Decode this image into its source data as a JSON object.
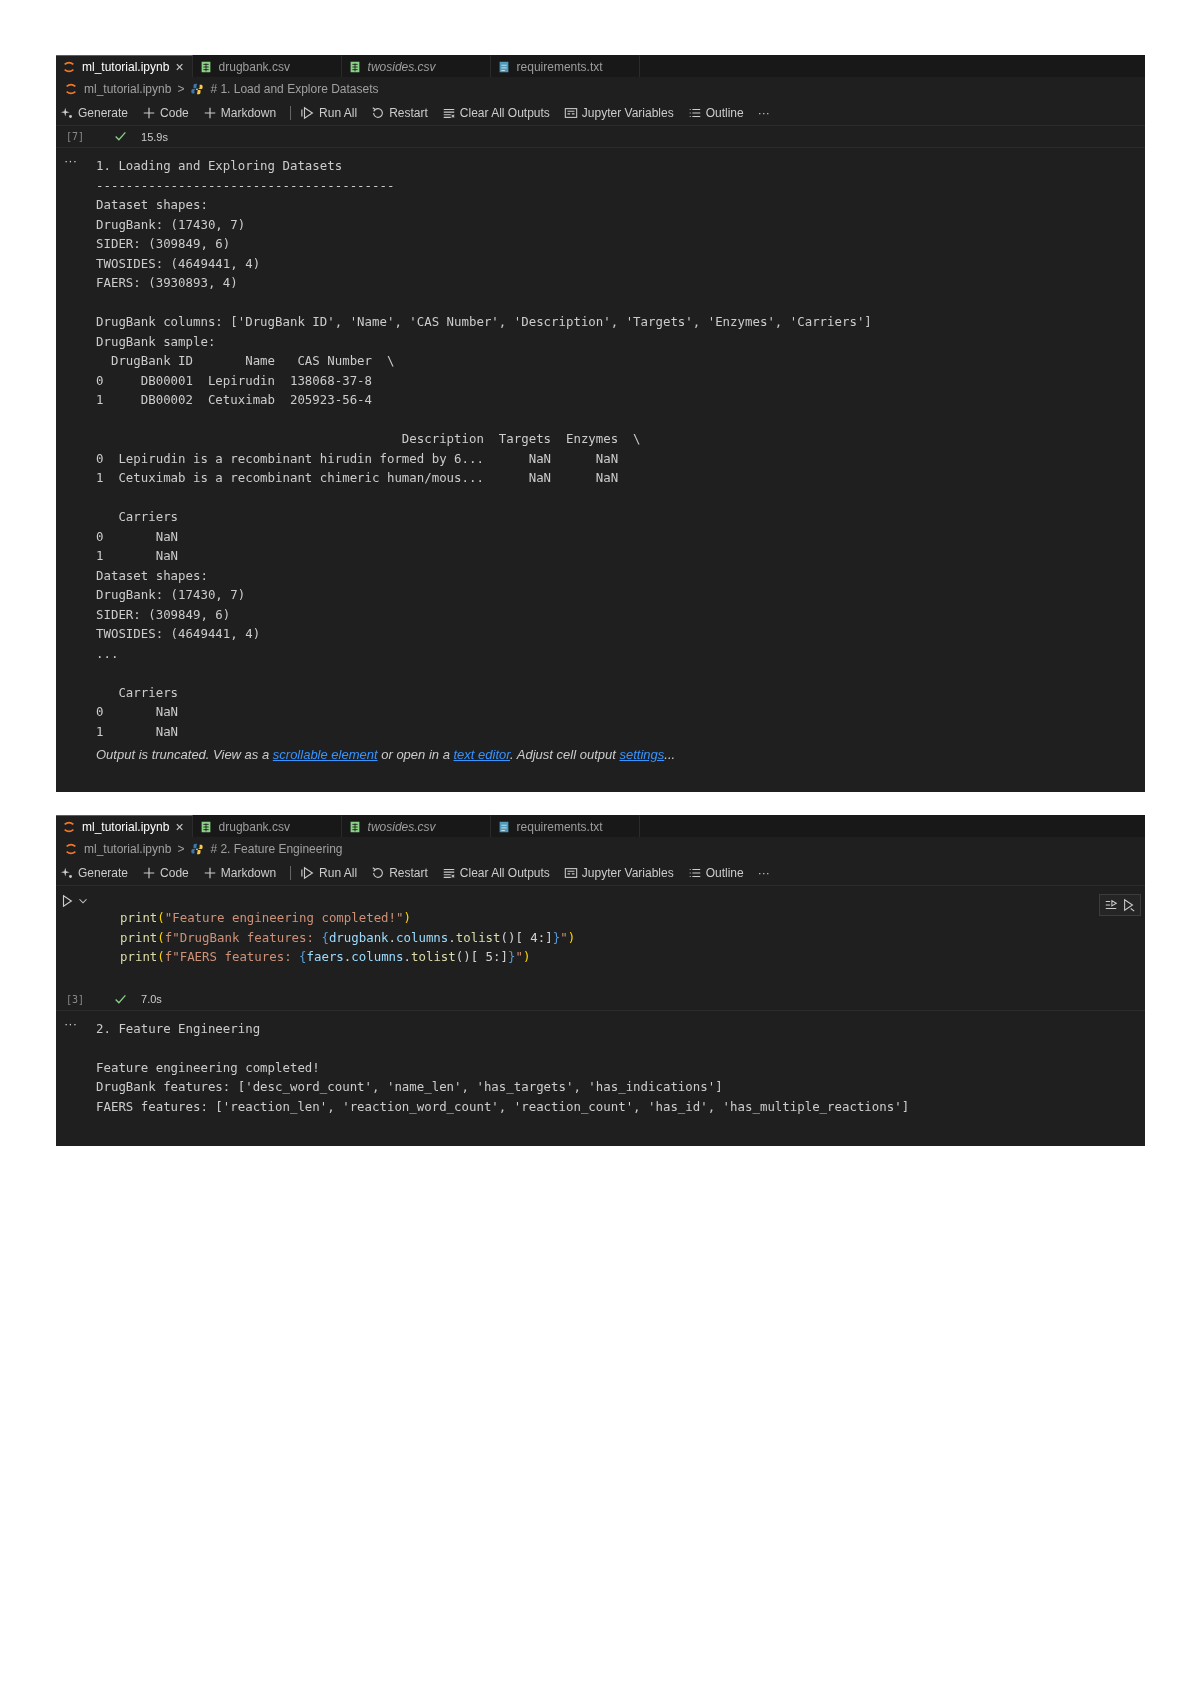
{
  "notebooks": [
    {
      "tabs": [
        {
          "label": "ml_tutorial.ipynb",
          "selected": true,
          "italic": false,
          "close": "×"
        },
        {
          "label": "drugbank.csv",
          "selected": false,
          "italic": false
        },
        {
          "label": "twosides.csv",
          "selected": false,
          "italic": true
        },
        {
          "label": "requirements.txt",
          "selected": false,
          "italic": false
        }
      ],
      "breadcrumb": {
        "file": "ml_tutorial.ipynb",
        "separator": ">",
        "section": "# 1. Load and Explore Datasets"
      },
      "toolbar": [
        "Generate",
        "Code",
        "Markdown",
        "Run All",
        "Restart",
        "Clear All Outputs",
        "Jupyter Variables",
        "Outline"
      ],
      "more": "···",
      "cell_status": {
        "count": "[7]",
        "time": "15.9s"
      },
      "output": {
        "menu": "···",
        "blocks": [
          [
            "1. Loading and Exploring Datasets",
            "----------------------------------------",
            "Dataset shapes:",
            "DrugBank: (17430, 7)",
            "SIDER: (309849, 6)",
            "TWOSIDES: (4649441, 4)",
            "FAERS: (3930893, 4)"
          ],
          [
            "DrugBank columns: ['DrugBank ID', 'Name', 'CAS Number', 'Description', 'Targets', 'Enzymes', 'Carriers']",
            "DrugBank sample:",
            "  DrugBank ID       Name   CAS Number  \\",
            "0     DB00001  Lepirudin  138068-37-8",
            "1     DB00002  Cetuximab  205923-56-4"
          ],
          [
            "                                         Description  Targets  Enzymes  \\",
            "0  Lepirudin is a recombinant hirudin formed by 6...      NaN      NaN",
            "1  Cetuximab is a recombinant chimeric human/mous...      NaN      NaN"
          ],
          [
            "   Carriers",
            "0       NaN",
            "1       NaN",
            "Dataset shapes:",
            "DrugBank: (17430, 7)",
            "SIDER: (309849, 6)",
            "TWOSIDES: (4649441, 4)",
            "..."
          ],
          [
            "   Carriers",
            "0       NaN",
            "1       NaN"
          ]
        ],
        "note": [
          {
            "kind": "text",
            "text": "Output is truncated. View as a "
          },
          {
            "kind": "link",
            "text": "scrollable element"
          },
          {
            "kind": "text",
            "text": " or open in a "
          },
          {
            "kind": "link",
            "text": "text editor"
          },
          {
            "kind": "text",
            "text": ". Adjust cell output "
          },
          {
            "kind": "link",
            "text": "settings"
          },
          {
            "kind": "text",
            "text": "..."
          }
        ]
      }
    },
    {
      "tabs": [
        {
          "label": "ml_tutorial.ipynb",
          "selected": true,
          "italic": false,
          "close": "×"
        },
        {
          "label": "drugbank.csv",
          "selected": false,
          "italic": false
        },
        {
          "label": "twosides.csv",
          "selected": false,
          "italic": true
        },
        {
          "label": "requirements.txt",
          "selected": false,
          "italic": false
        }
      ],
      "breadcrumb": {
        "file": "ml_tutorial.ipynb",
        "separator": ">",
        "section": "# 2. Feature Engineering"
      },
      "toolbar": [
        "Generate",
        "Code",
        "Markdown",
        "Run All",
        "Restart",
        "Clear All Outputs",
        "Jupyter Variables",
        "Outline"
      ],
      "more": "···",
      "code_lines": [
        [
          {
            "kind": "func",
            "text": "print"
          },
          {
            "kind": "paren",
            "text": "("
          },
          {
            "kind": "string",
            "text": "\"Feature engineering completed!\""
          },
          {
            "kind": "paren",
            "text": ")"
          }
        ],
        [
          {
            "kind": "func",
            "text": "print"
          },
          {
            "kind": "paren",
            "text": "("
          },
          {
            "kind": "string",
            "text": "f\"DrugBank features: "
          },
          {
            "kind": "brace",
            "text": "{"
          },
          {
            "kind": "var",
            "text": "drugbank"
          },
          {
            "kind": "punct",
            "text": "."
          },
          {
            "kind": "var",
            "text": "columns"
          },
          {
            "kind": "punct",
            "text": "."
          },
          {
            "kind": "func",
            "text": "tolist"
          },
          {
            "kind": "punct",
            "text": "()[ 4:]"
          },
          {
            "kind": "brace",
            "text": "}"
          },
          {
            "kind": "string",
            "text": "\""
          },
          {
            "kind": "paren",
            "text": ")"
          }
        ],
        [
          {
            "kind": "func",
            "text": "print"
          },
          {
            "kind": "paren",
            "text": "("
          },
          {
            "kind": "string",
            "text": "f\"FAERS features: "
          },
          {
            "kind": "brace",
            "text": "{"
          },
          {
            "kind": "var",
            "text": "faers"
          },
          {
            "kind": "punct",
            "text": "."
          },
          {
            "kind": "var",
            "text": "columns"
          },
          {
            "kind": "punct",
            "text": "."
          },
          {
            "kind": "func",
            "text": "tolist"
          },
          {
            "kind": "punct",
            "text": "()[ 5:]"
          },
          {
            "kind": "brace",
            "text": "}"
          },
          {
            "kind": "string",
            "text": "\""
          },
          {
            "kind": "paren",
            "text": ")"
          }
        ]
      ],
      "cell_status": {
        "count": "[3]",
        "time": "7.0s"
      },
      "output": {
        "menu": "···",
        "blocks": [
          [
            "2. Feature Engineering"
          ],
          [
            "Feature engineering completed!",
            "DrugBank features: ['desc_word_count', 'name_len', 'has_targets', 'has_indications']",
            "FAERS features: ['reaction_len', 'reaction_word_count', 'reaction_count', 'has_id', 'has_multiple_reactions']"
          ]
        ]
      }
    }
  ]
}
